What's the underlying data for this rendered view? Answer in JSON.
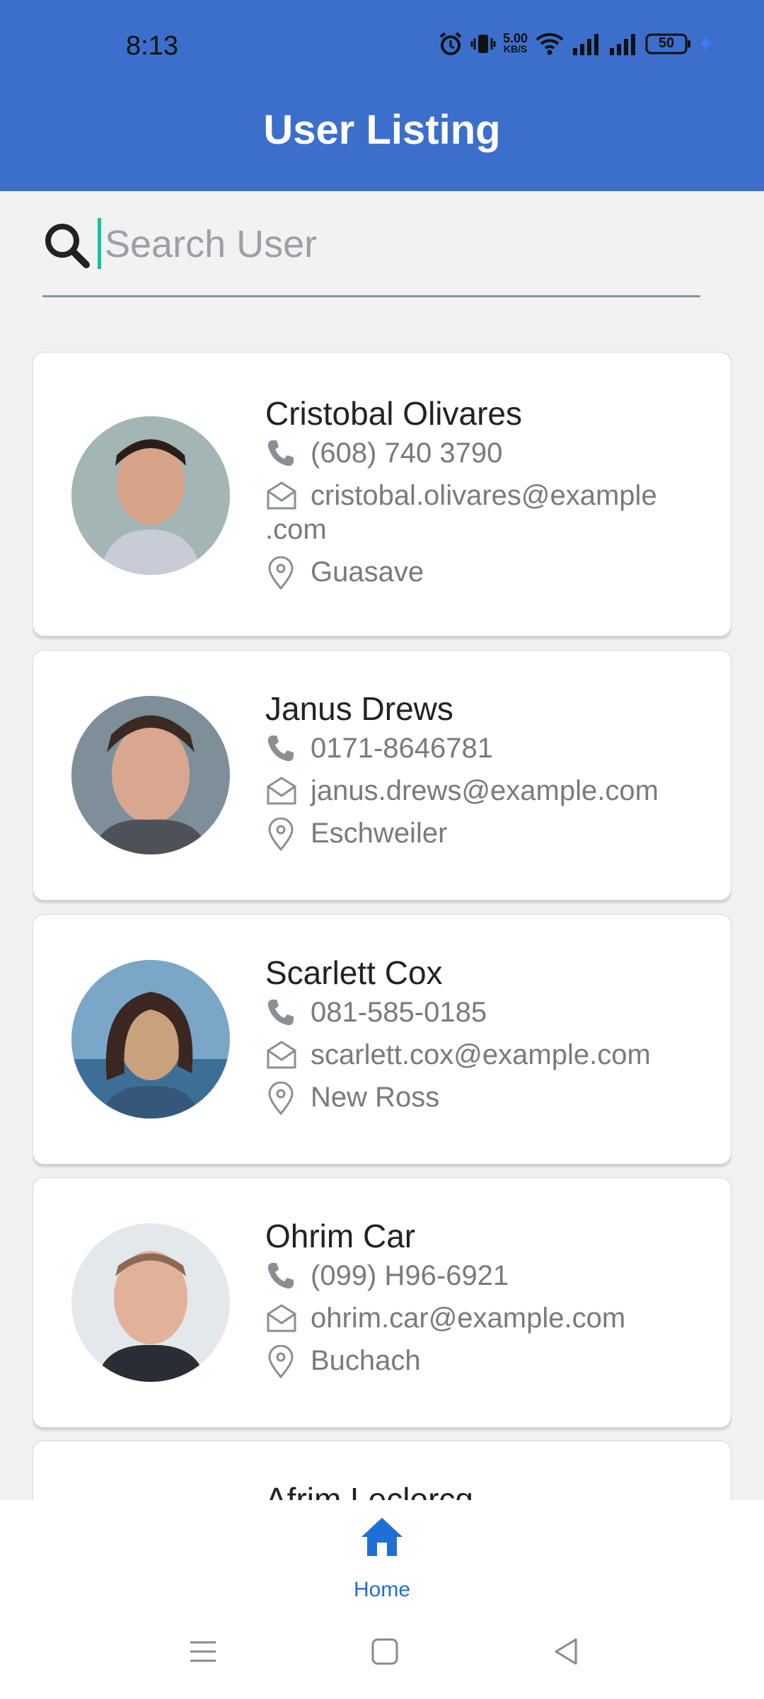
{
  "status": {
    "time": "8:13",
    "net_speed_top": "5.00",
    "net_speed_bottom": "KB/S",
    "battery": "50"
  },
  "appbar": {
    "title": "User Listing"
  },
  "search": {
    "placeholder": "Search User",
    "value": ""
  },
  "users": [
    {
      "name": "Cristobal Olivares",
      "phone": "(608) 740 3790",
      "email_line1": "cristobal.olivares@example",
      "email_line2": ".com",
      "city": "Guasave"
    },
    {
      "name": "Janus Drews",
      "phone": "0171-8646781",
      "email": "janus.drews@example.com",
      "city": "Eschweiler"
    },
    {
      "name": "Scarlett Cox",
      "phone": "081-585-0185",
      "email": "scarlett.cox@example.com",
      "city": "New Ross"
    },
    {
      "name": "Ohrim Car",
      "phone": "(099) H96-6921",
      "email": "ohrim.car@example.com",
      "city": "Buchach"
    },
    {
      "name": "Afrim Leclercq"
    }
  ],
  "bottom_nav": {
    "home_label": "Home"
  },
  "colors": {
    "primary": "#3b6fcb",
    "accent": "#1f6fd6",
    "caret": "#14c0a4"
  }
}
